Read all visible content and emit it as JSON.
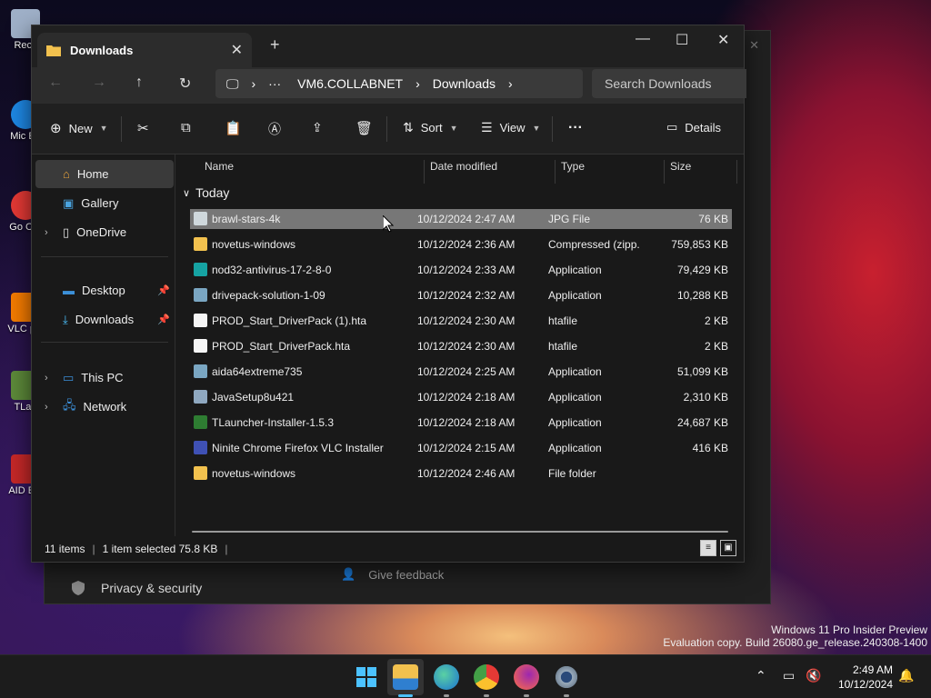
{
  "desktop": {
    "icons": [
      {
        "label": "Recy",
        "color": "#9fb0c8"
      },
      {
        "label": "Mic Ed",
        "color": "#1e88e5"
      },
      {
        "label": "Go Chr",
        "color": "#e53935"
      },
      {
        "label": "VLC pla",
        "color": "#f57c00"
      },
      {
        "label": "TLau",
        "color": "#5d8a3a"
      },
      {
        "label": "AID Ext",
        "color": "#c62828"
      }
    ]
  },
  "settings": {
    "privacy_label": "Privacy & security",
    "feedback_label": "Give feedback"
  },
  "explorer": {
    "tab_title": "Downloads",
    "search_placeholder": "Search Downloads",
    "breadcrumb": {
      "ellipsis": "···",
      "host": "VM6.COLLABNET",
      "folder": "Downloads"
    },
    "commands": {
      "new": "New",
      "sort": "Sort",
      "view": "View",
      "more": "···",
      "details": "Details"
    },
    "sidebar": [
      {
        "label": "Home",
        "icon": "home-icon",
        "color": "#e8a33c"
      },
      {
        "label": "Gallery",
        "icon": "gallery-icon",
        "color": "#4aa3df"
      },
      {
        "label": "OneDrive",
        "icon": "document-icon",
        "color": "#e0e0e0"
      },
      {
        "label": "Desktop",
        "icon": "desktop-icon",
        "color": "#3c8fd8"
      },
      {
        "label": "Downloads",
        "icon": "download-icon",
        "color": "#4cc2ff"
      },
      {
        "label": "This PC",
        "icon": "computer-icon",
        "color": "#3c8fd8"
      },
      {
        "label": "Network",
        "icon": "network-icon",
        "color": "#3c8fd8"
      }
    ],
    "columns": {
      "name": "Name",
      "date": "Date modified",
      "type": "Type",
      "size": "Size"
    },
    "group_label": "Today",
    "files": [
      {
        "name": "brawl-stars-4k",
        "date": "10/12/2024 2:47 AM",
        "type": "JPG File",
        "size": "76 KB",
        "color": "#cfd8dc"
      },
      {
        "name": "novetus-windows",
        "date": "10/12/2024 2:36 AM",
        "type": "Compressed (zipp...",
        "size": "759,853 KB",
        "color": "#f2c14e"
      },
      {
        "name": "nod32-antivirus-17-2-8-0",
        "date": "10/12/2024 2:33 AM",
        "type": "Application",
        "size": "79,429 KB",
        "color": "#16a3a3"
      },
      {
        "name": "drivepack-solution-1-09",
        "date": "10/12/2024 2:32 AM",
        "type": "Application",
        "size": "10,288 KB",
        "color": "#7aa6c2"
      },
      {
        "name": "PROD_Start_DriverPack (1).hta",
        "date": "10/12/2024 2:30 AM",
        "type": "htafile",
        "size": "2 KB",
        "color": "#f5f5f5"
      },
      {
        "name": "PROD_Start_DriverPack.hta",
        "date": "10/12/2024 2:30 AM",
        "type": "htafile",
        "size": "2 KB",
        "color": "#f5f5f5"
      },
      {
        "name": "aida64extreme735",
        "date": "10/12/2024 2:25 AM",
        "type": "Application",
        "size": "51,099 KB",
        "color": "#7aa6c2"
      },
      {
        "name": "JavaSetup8u421",
        "date": "10/12/2024 2:18 AM",
        "type": "Application",
        "size": "2,310 KB",
        "color": "#8fa8c0"
      },
      {
        "name": "TLauncher-Installer-1.5.3",
        "date": "10/12/2024 2:18 AM",
        "type": "Application",
        "size": "24,687 KB",
        "color": "#2e7d32"
      },
      {
        "name": "Ninite Chrome Firefox VLC Installer",
        "date": "10/12/2024 2:15 AM",
        "type": "Application",
        "size": "416 KB",
        "color": "#3f51b5"
      },
      {
        "name": "novetus-windows",
        "date": "10/12/2024 2:46 AM",
        "type": "File folder",
        "size": "",
        "color": "#f2c14e"
      }
    ],
    "status": {
      "count": "11 items",
      "selection": "1 item selected  75.8 KB"
    }
  },
  "taskbar": {
    "time": "2:49 AM",
    "date": "10/12/2024",
    "apps": [
      "start-icon",
      "file-explorer-icon",
      "edge-icon",
      "chrome-icon",
      "firefox-icon",
      "settings-icon"
    ]
  },
  "watermark": {
    "line1": "Windows 11 Pro Insider Preview",
    "line2": "Evaluation copy. Build 26080.ge_release.240308-1400"
  }
}
